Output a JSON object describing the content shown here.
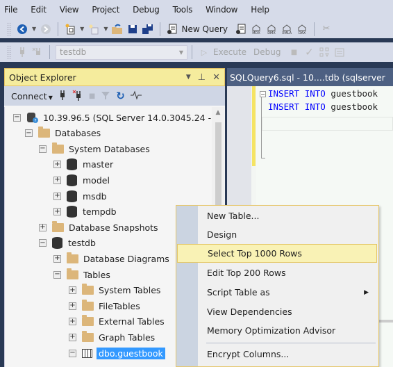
{
  "menubar": {
    "items": [
      "File",
      "Edit",
      "View",
      "Project",
      "Debug",
      "Tools",
      "Window",
      "Help"
    ]
  },
  "toolbar1": {
    "new_query_label": "New Query",
    "icons": [
      "back-icon",
      "forward-icon",
      "new-project-icon",
      "new-file-icon",
      "open-file-icon",
      "save-icon",
      "save-all-icon",
      "new-query-icon",
      "db-query-icon",
      "mdx-query-icon",
      "dmx-query-icon",
      "xmla-query-icon",
      "dax-query-icon",
      "cut-icon"
    ],
    "mdx_label": "MDX",
    "dmx_label": "DMX",
    "xmla_label": "XMLA",
    "dax_label": "DAX"
  },
  "toolbar2": {
    "database_value": "testdb",
    "execute_label": "Execute",
    "debug_label": "Debug"
  },
  "object_explorer": {
    "title": "Object Explorer",
    "connect_label": "Connect",
    "tree": [
      {
        "label": "10.39.96.5 (SQL Server 14.0.3045.24 -",
        "icon": "server-icon",
        "expander": "minus",
        "level": 0
      },
      {
        "label": "Databases",
        "icon": "folder-icon",
        "expander": "minus",
        "level": 1
      },
      {
        "label": "System Databases",
        "icon": "folder-icon",
        "expander": "minus",
        "level": 2
      },
      {
        "label": "master",
        "icon": "database-icon",
        "expander": "plus",
        "level": 3
      },
      {
        "label": "model",
        "icon": "database-icon",
        "expander": "plus",
        "level": 3
      },
      {
        "label": "msdb",
        "icon": "database-icon",
        "expander": "plus",
        "level": 3
      },
      {
        "label": "tempdb",
        "icon": "database-icon",
        "expander": "plus",
        "level": 3
      },
      {
        "label": "Database Snapshots",
        "icon": "folder-icon",
        "expander": "plus",
        "level": 2
      },
      {
        "label": "testdb",
        "icon": "database-icon",
        "expander": "minus",
        "level": 2
      },
      {
        "label": "Database Diagrams",
        "icon": "folder-icon",
        "expander": "plus",
        "level": 3
      },
      {
        "label": "Tables",
        "icon": "folder-icon",
        "expander": "minus",
        "level": 3
      },
      {
        "label": "System Tables",
        "icon": "folder-icon",
        "expander": "plus",
        "level": 4
      },
      {
        "label": "FileTables",
        "icon": "folder-icon",
        "expander": "plus",
        "level": 4
      },
      {
        "label": "External Tables",
        "icon": "folder-icon",
        "expander": "plus",
        "level": 4
      },
      {
        "label": "Graph Tables",
        "icon": "folder-icon",
        "expander": "plus",
        "level": 4
      },
      {
        "label": "dbo.guestbook",
        "icon": "table-icon",
        "expander": "minus",
        "level": 4,
        "selected": true
      }
    ]
  },
  "editor": {
    "tab_title": "SQLQuery6.sql - 10....tdb (sqlserver",
    "lines": [
      {
        "keyword1": "INSERT",
        "keyword2": "INTO",
        "ident": "guestbook"
      },
      {
        "keyword1": "INSERT",
        "keyword2": "INTO",
        "ident": "guestbook"
      }
    ]
  },
  "context_menu": {
    "items": [
      {
        "label": "New Table..."
      },
      {
        "label": "Design"
      },
      {
        "label": "Select Top 1000 Rows",
        "highlighted": true
      },
      {
        "label": "Edit Top 200 Rows"
      },
      {
        "label": "Script Table as",
        "submenu": true
      },
      {
        "label": "View Dependencies"
      },
      {
        "label": "Memory Optimization Advisor"
      },
      {
        "label": "Encrypt Columns..."
      }
    ]
  }
}
